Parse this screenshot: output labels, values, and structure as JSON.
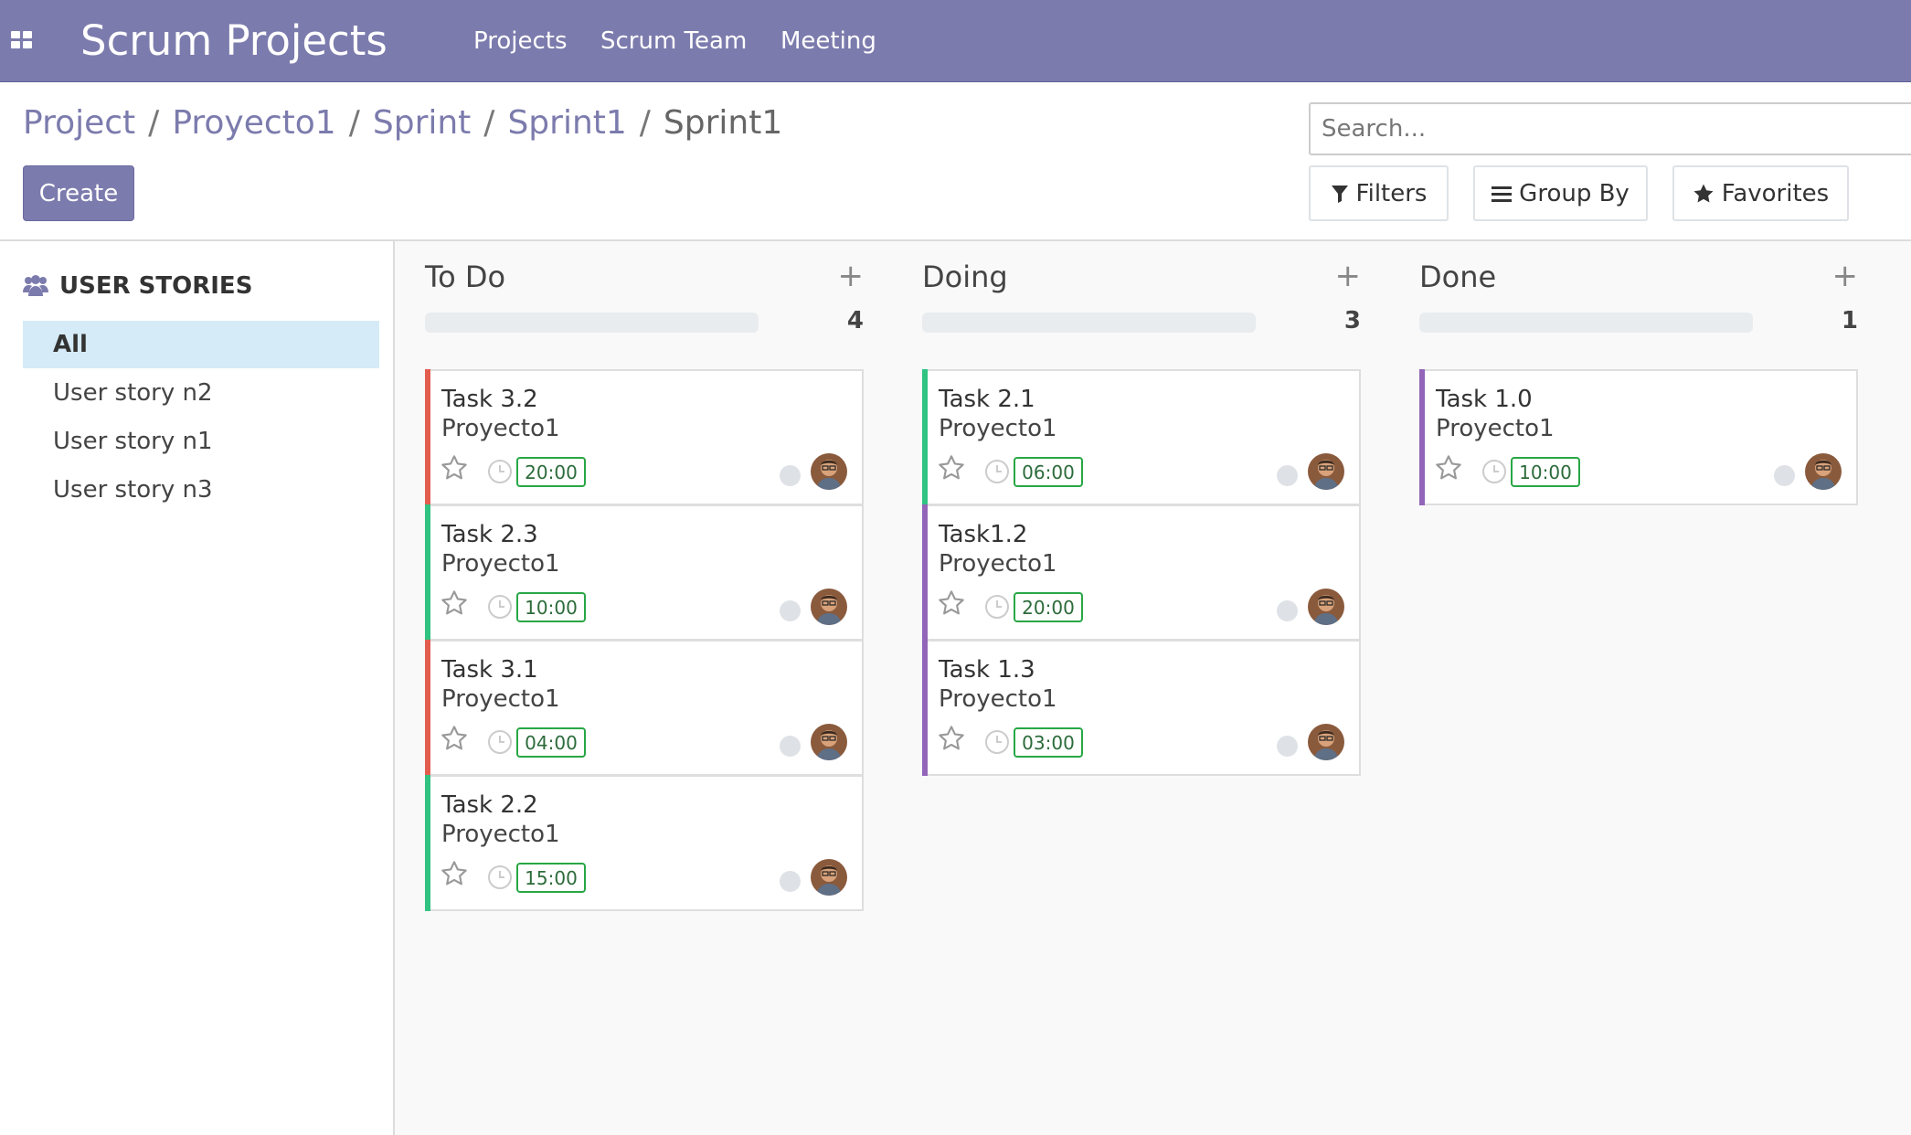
{
  "navbar": {
    "brand": "Scrum Projects",
    "menu": [
      {
        "label": "Projects"
      },
      {
        "label": "Scrum Team"
      },
      {
        "label": "Meeting"
      }
    ],
    "color": "#7c7bad"
  },
  "breadcrumb": {
    "items": [
      "Project",
      "Proyecto1",
      "Sprint",
      "Sprint1"
    ],
    "current": "Sprint1",
    "separator": "/"
  },
  "actions": {
    "create_label": "Create"
  },
  "search": {
    "placeholder": "Search...",
    "value": ""
  },
  "controls": {
    "filters_label": "Filters",
    "group_by_label": "Group By",
    "favorites_label": "Favorites"
  },
  "sidebar": {
    "header": "USER STORIES",
    "items": [
      {
        "label": "All",
        "active": true
      },
      {
        "label": "User story n2",
        "active": false
      },
      {
        "label": "User story n1",
        "active": false
      },
      {
        "label": "User story n3",
        "active": false
      }
    ]
  },
  "columns": [
    {
      "title": "To Do",
      "count": "4",
      "cards": [
        {
          "title": "Task 3.2",
          "project": "Proyecto1",
          "hours": "20:00",
          "color": "#e35d4e"
        },
        {
          "title": "Task 2.3",
          "project": "Proyecto1",
          "hours": "10:00",
          "color": "#30c381"
        },
        {
          "title": "Task 3.1",
          "project": "Proyecto1",
          "hours": "04:00",
          "color": "#e35d4e"
        },
        {
          "title": "Task 2.2",
          "project": "Proyecto1",
          "hours": "15:00",
          "color": "#30c381"
        }
      ]
    },
    {
      "title": "Doing",
      "count": "3",
      "cards": [
        {
          "title": "Task 2.1",
          "project": "Proyecto1",
          "hours": "06:00",
          "color": "#30c381"
        },
        {
          "title": "Task1.2",
          "project": "Proyecto1",
          "hours": "20:00",
          "color": "#9365b8"
        },
        {
          "title": "Task 1.3",
          "project": "Proyecto1",
          "hours": "03:00",
          "color": "#9365b8"
        }
      ]
    },
    {
      "title": "Done",
      "count": "1",
      "cards": [
        {
          "title": "Task 1.0",
          "project": "Proyecto1",
          "hours": "10:00",
          "color": "#9365b8"
        }
      ]
    }
  ]
}
